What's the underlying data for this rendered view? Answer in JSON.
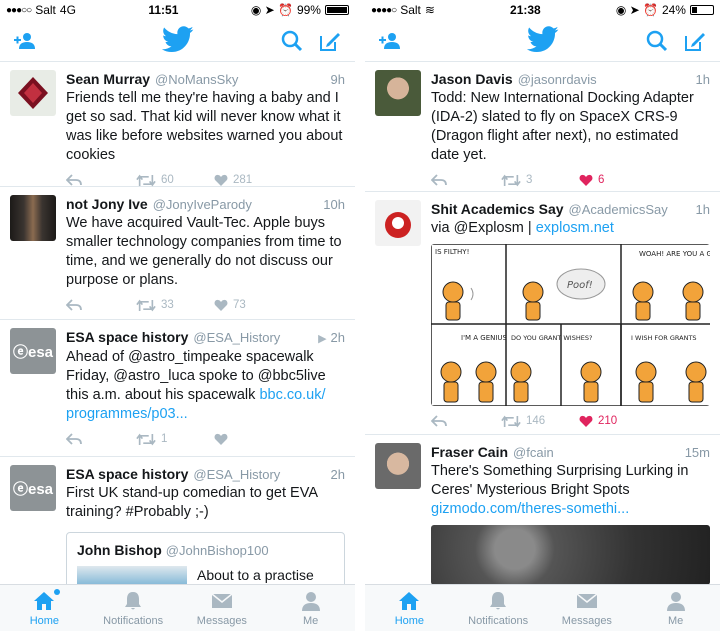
{
  "colors": {
    "accent": "#1da1f2",
    "heart": "#e0245e",
    "muted": "#aab8c2"
  },
  "phones": [
    {
      "status": {
        "carrier": "Salt",
        "network": "4G",
        "time": "11:51",
        "battery": "99%",
        "battery_level": 0.99
      },
      "tweets": [
        {
          "name": "Sean Murray",
          "handle": "@NoMansSky",
          "time": "9h",
          "text": "Friends tell me they're having a baby and I get so sad. That kid will never know what it was like before websites warned you about cookies",
          "retweets": "60",
          "likes": "281"
        },
        {
          "name": "not Jony Ive",
          "handle": "@JonyIveParody",
          "time": "10h",
          "text": "We have acquired Vault-Tec. Apple buys smaller technology companies from time to time, and we generally do not discuss our purpose or plans.",
          "retweets": "33",
          "likes": "73"
        },
        {
          "name": "ESA space history",
          "handle": "@ESA_History",
          "time": "2h",
          "text": "Ahead of @astro_timpeake spacewalk Friday, @astro_luca spoke to @bbc5live this a.m. about his spacewalk ",
          "link": "bbc.co.uk/ programmes/p03...",
          "retweets": "1",
          "likes": ""
        },
        {
          "name": "ESA space history",
          "handle": "@ESA_History",
          "time": "2h",
          "text": "First UK stand-up comedian to get EVA training? #Probably ;-)",
          "quote": {
            "name": "John Bishop",
            "handle": "@JohnBishop100",
            "text": "About to a practise dive into the"
          }
        }
      ],
      "tabs": [
        "Home",
        "Notifications",
        "Messages",
        "Me"
      ]
    },
    {
      "status": {
        "carrier": "Salt",
        "network": "",
        "time": "21:38",
        "battery": "24%",
        "battery_level": 0.24
      },
      "tweets": [
        {
          "name": "Jason Davis",
          "handle": "@jasonrdavis",
          "time": "1h",
          "text": "Todd: New International Docking Adapter (IDA-2) slated to fly on SpaceX CRS-9 (Dragon flight after next), no estimated date yet.",
          "retweets": "3",
          "likes": "6"
        },
        {
          "name": "Shit Academics Say",
          "handle": "@AcademicsSay",
          "time": "1h",
          "text": "via @Explosm | ",
          "link": "explosm.net",
          "retweets": "146",
          "likes": "210",
          "comic": {
            "p1": "IS FILTHY!",
            "p3": "WOAH! ARE YOU A GENIE?",
            "p2": "Poof!",
            "p4": "I'M A GENIUS",
            "p5": "DO YOU GRANT WISHES?",
            "p6": "I WISH FOR GRANTS"
          }
        },
        {
          "name": "Fraser Cain",
          "handle": "@fcain",
          "time": "15m",
          "text": "There's Something Surprising Lurking in Ceres' Mysterious Bright Spots ",
          "link": "gizmodo.com/theres-somethi..."
        }
      ],
      "tabs": [
        "Home",
        "Notifications",
        "Messages",
        "Me"
      ]
    }
  ]
}
